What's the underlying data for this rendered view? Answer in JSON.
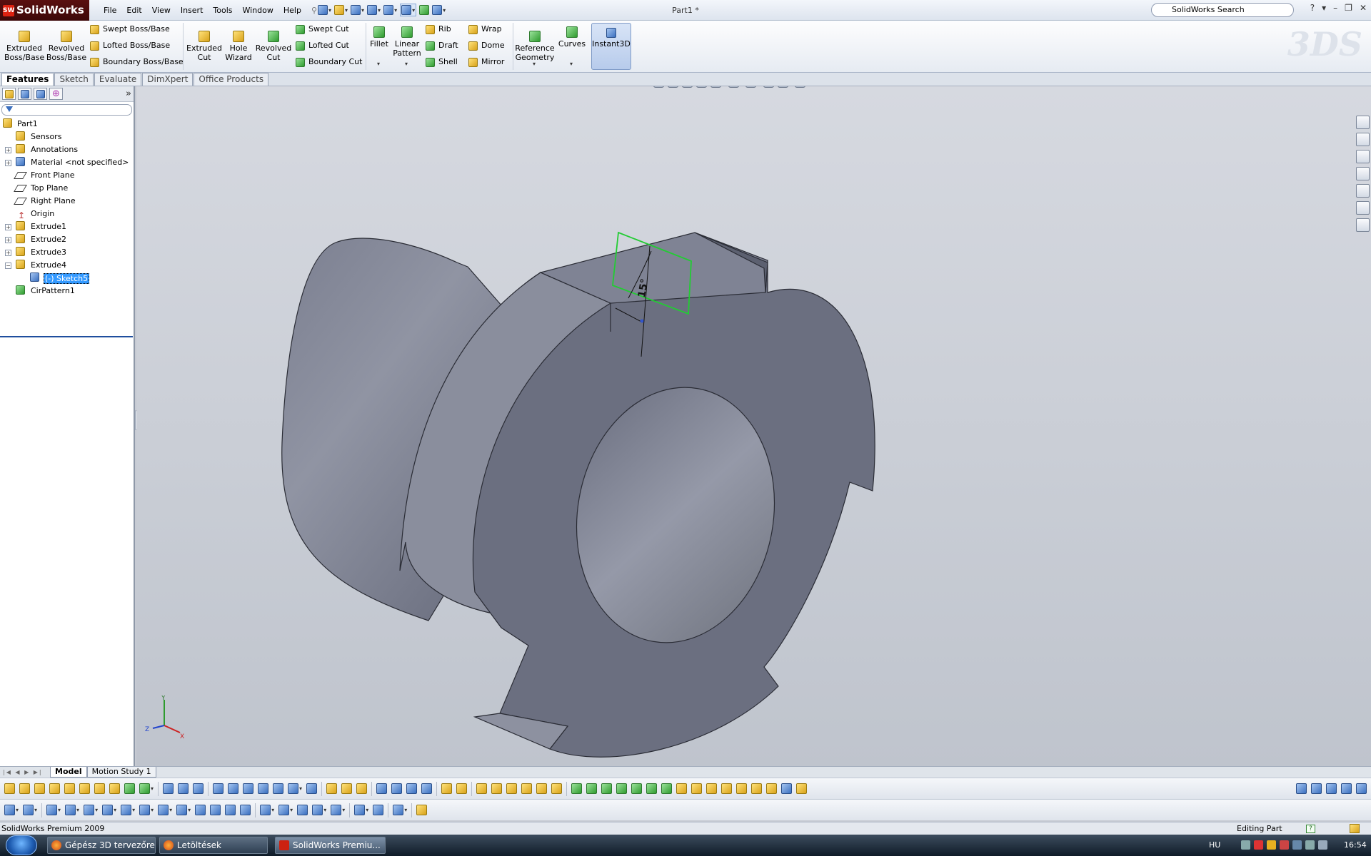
{
  "app": {
    "name": "SolidWorks",
    "doc_title": "Part1 *"
  },
  "menu": [
    "File",
    "Edit",
    "View",
    "Insert",
    "Tools",
    "Window",
    "Help"
  ],
  "search": {
    "placeholder": "SolidWorks Search"
  },
  "ribbon": {
    "extruded_boss": [
      "Extruded",
      "Boss/Base"
    ],
    "revolved_boss": [
      "Revolved",
      "Boss/Base"
    ],
    "swept_boss": "Swept Boss/Base",
    "lofted_boss": "Lofted Boss/Base",
    "boundary_boss": "Boundary Boss/Base",
    "extruded_cut": [
      "Extruded",
      "Cut"
    ],
    "hole_wizard": [
      "Hole",
      "Wizard"
    ],
    "revolved_cut": [
      "Revolved",
      "Cut"
    ],
    "swept_cut": "Swept Cut",
    "lofted_cut": "Lofted Cut",
    "boundary_cut": "Boundary Cut",
    "fillet": "Fillet",
    "linear_pattern": [
      "Linear",
      "Pattern"
    ],
    "rib": "Rib",
    "draft": "Draft",
    "shell": "Shell",
    "wrap": "Wrap",
    "dome": "Dome",
    "mirror": "Mirror",
    "reference_geometry": [
      "Reference",
      "Geometry"
    ],
    "curves": "Curves",
    "instant3d": "Instant3D"
  },
  "command_tabs": [
    {
      "label": "Features",
      "active": true
    },
    {
      "label": "Sketch",
      "active": false
    },
    {
      "label": "Evaluate",
      "active": false
    },
    {
      "label": "DimXpert",
      "active": false
    },
    {
      "label": "Office Products",
      "active": false
    }
  ],
  "tree": {
    "items": [
      {
        "label": "Part1"
      },
      {
        "label": "Sensors"
      },
      {
        "label": "Annotations"
      },
      {
        "label": "Material <not specified>"
      },
      {
        "label": "Front Plane"
      },
      {
        "label": "Top Plane"
      },
      {
        "label": "Right Plane"
      },
      {
        "label": "Origin"
      },
      {
        "label": "Extrude1"
      },
      {
        "label": "Extrude2"
      },
      {
        "label": "Extrude3"
      },
      {
        "label": "Extrude4"
      },
      {
        "label": "(-) Sketch5"
      },
      {
        "label": "CirPattern1"
      }
    ]
  },
  "viewport": {
    "dimension": "15°",
    "axis_labels": {
      "y": "Y",
      "z": "Z",
      "x": "X"
    }
  },
  "bottom_tabs": [
    "Model",
    "Motion Study 1"
  ],
  "status": {
    "left": "SolidWorks Premium 2009",
    "right": "Editing Part",
    "help": "?"
  },
  "taskbar": {
    "tasks": [
      "Gépész 3D tervezőre...",
      "Letöltések",
      "SolidWorks Premiu..."
    ],
    "lang": "HU",
    "clock": "16:54"
  },
  "colors": {
    "part": "#6a6e7f",
    "sketch": "#22cc33",
    "selection": "#3399ff"
  }
}
